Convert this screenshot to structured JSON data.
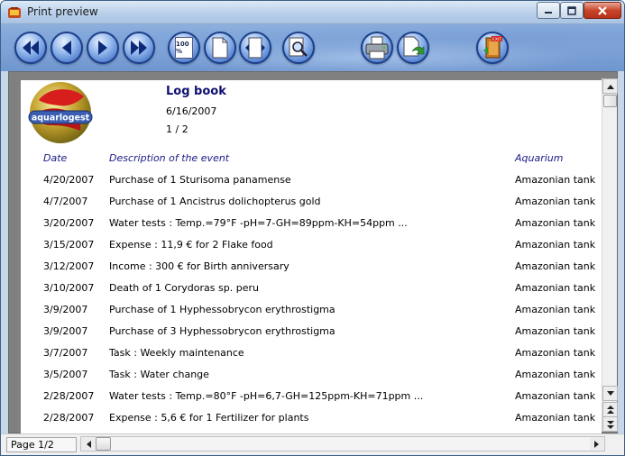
{
  "window": {
    "title": "Print preview",
    "colors": {
      "close": "#c8442a",
      "toolbar": "#7aa0d6",
      "title_text": "#101070"
    }
  },
  "toolbar": {
    "buttons": [
      {
        "name": "first-page-button",
        "icon": "double-left-arrow-icon"
      },
      {
        "name": "previous-page-button",
        "icon": "left-arrow-icon"
      },
      {
        "name": "next-page-button",
        "icon": "right-arrow-icon"
      },
      {
        "name": "last-page-button",
        "icon": "double-right-arrow-icon"
      },
      {
        "name": "zoom-100-button",
        "icon": "page-100-icon",
        "label": "100 %"
      },
      {
        "name": "whole-page-button",
        "icon": "page-icon"
      },
      {
        "name": "page-width-button",
        "icon": "page-width-icon"
      },
      {
        "name": "zoom-button",
        "icon": "magnifier-icon"
      },
      {
        "name": "print-button",
        "icon": "printer-icon"
      },
      {
        "name": "export-button",
        "icon": "export-page-icon"
      },
      {
        "name": "exit-button",
        "icon": "exit-door-icon",
        "label": "EXIT"
      }
    ]
  },
  "report": {
    "logo_text": "aquarlogest",
    "title": "Log book",
    "date": "6/16/2007",
    "pages": "1 / 2",
    "columns": {
      "date": "Date",
      "description": "Description of the event",
      "aquarium": "Aquarium"
    },
    "rows": [
      {
        "date": "4/20/2007",
        "description": "Purchase of 1 Sturisoma panamense",
        "aquarium": "Amazonian tank"
      },
      {
        "date": "4/7/2007",
        "description": "Purchase of 1 Ancistrus dolichopterus gold",
        "aquarium": "Amazonian tank"
      },
      {
        "date": "3/20/2007",
        "description": "Water tests : Temp.=79°F -pH=7-GH=89ppm-KH=54ppm ...",
        "aquarium": "Amazonian tank"
      },
      {
        "date": "3/15/2007",
        "description": "Expense : 11,9 € for 2 Flake food",
        "aquarium": "Amazonian tank"
      },
      {
        "date": "3/12/2007",
        "description": "Income : 300 € for Birth anniversary",
        "aquarium": "Amazonian tank"
      },
      {
        "date": "3/10/2007",
        "description": "Death of 1 Corydoras sp. peru",
        "aquarium": "Amazonian tank"
      },
      {
        "date": "3/9/2007",
        "description": "Purchase of 1 Hyphessobrycon erythrostigma",
        "aquarium": "Amazonian tank"
      },
      {
        "date": "3/9/2007",
        "description": "Purchase of 3 Hyphessobrycon erythrostigma",
        "aquarium": "Amazonian tank"
      },
      {
        "date": "3/7/2007",
        "description": "Task : Weekly maintenance",
        "aquarium": "Amazonian tank"
      },
      {
        "date": "3/5/2007",
        "description": "Task : Water change",
        "aquarium": "Amazonian tank"
      },
      {
        "date": "2/28/2007",
        "description": "Water tests : Temp.=80°F -pH=6,7-GH=125ppm-KH=71ppm ...",
        "aquarium": "Amazonian tank"
      },
      {
        "date": "2/28/2007",
        "description": "Expense : 5,6 € for 1 Fertilizer for plants",
        "aquarium": "Amazonian tank"
      }
    ]
  },
  "status": {
    "page": "Page 1/2"
  }
}
